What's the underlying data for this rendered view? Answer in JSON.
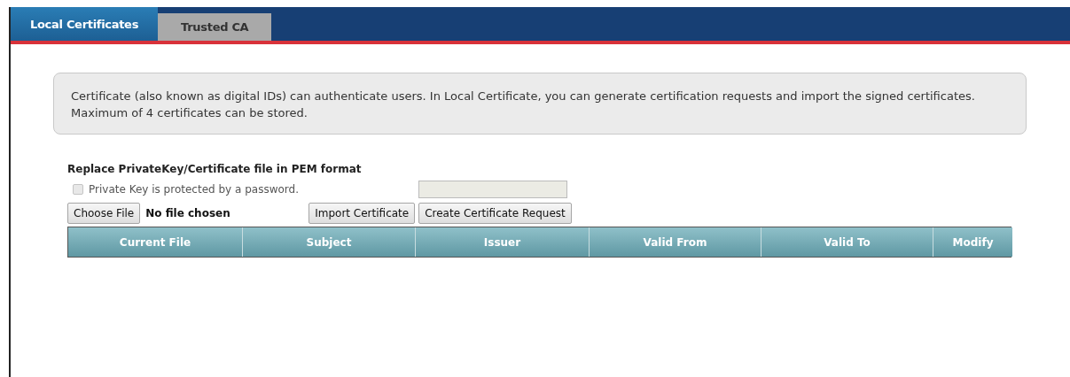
{
  "tabs": [
    {
      "label": "Local Certificates",
      "selected": true
    },
    {
      "label": "Trusted CA",
      "selected": false
    }
  ],
  "info": "Certificate (also known as digital IDs) can authenticate users. In Local Certificate, you can generate certification requests and import the signed certificates. Maximum of 4 certificates can be stored.",
  "section_title": "Replace PrivateKey/Certificate file in PEM format",
  "password_option": {
    "label": "Private Key is protected by a password.",
    "checked": false,
    "disabled": true
  },
  "file_picker": {
    "button": "Choose File",
    "status": "No file chosen"
  },
  "buttons": [
    "Import Certificate",
    "Create Certificate Request"
  ],
  "table": {
    "columns": [
      "Current File",
      "Subject",
      "Issuer",
      "Valid From",
      "Valid To",
      "Modify"
    ]
  }
}
